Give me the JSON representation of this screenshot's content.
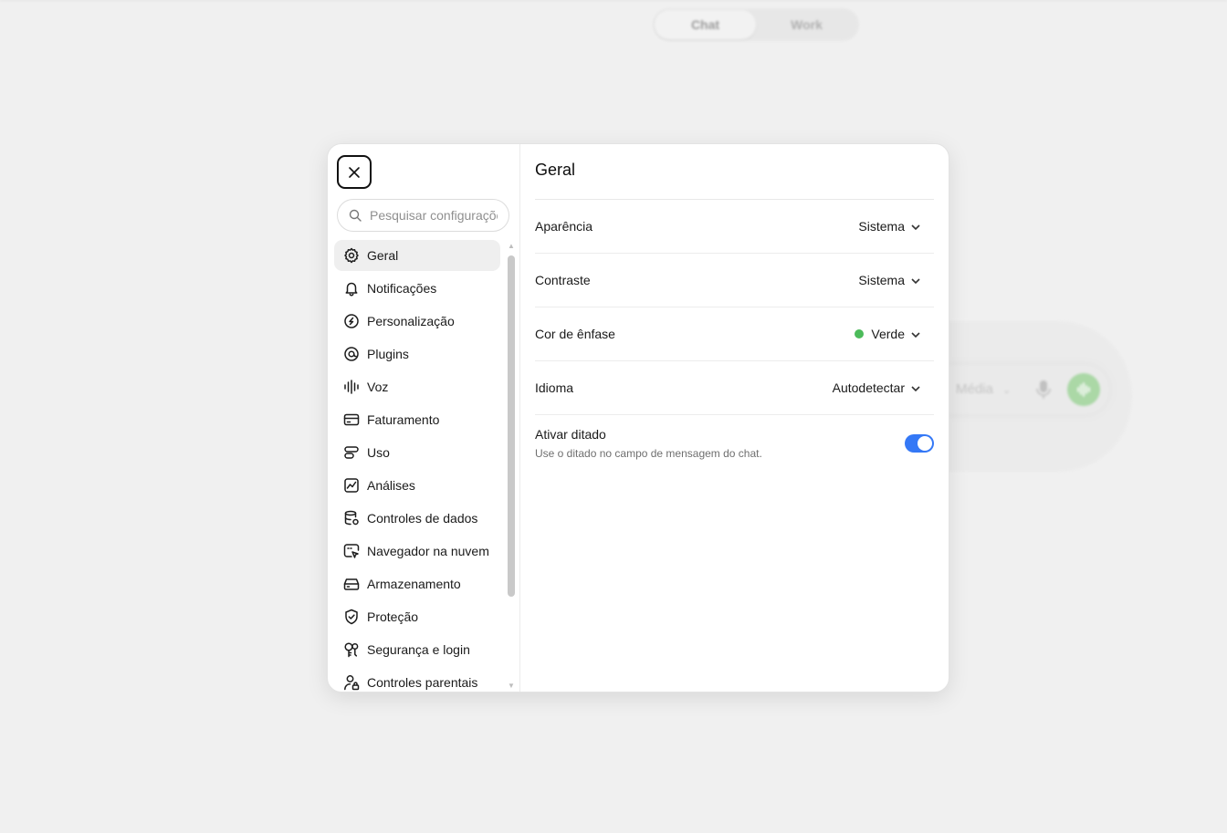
{
  "background": {
    "mode_tabs": [
      {
        "label": "Chat",
        "active": true
      },
      {
        "label": "Work",
        "active": false
      }
    ],
    "composer": {
      "model_label": "Média",
      "mic_icon": "microphone-icon",
      "voice_icon": "voice-waveform-icon",
      "voice_button_color": "#9fd49a"
    }
  },
  "settings": {
    "close_icon": "close-icon",
    "search": {
      "placeholder": "Pesquisar configurações",
      "value": ""
    },
    "nav_items": [
      {
        "label": "Geral",
        "icon": "gear-icon",
        "active": true
      },
      {
        "label": "Notificações",
        "icon": "bell-icon",
        "active": false
      },
      {
        "label": "Personalização",
        "icon": "personalization-icon",
        "active": false
      },
      {
        "label": "Plugins",
        "icon": "plugins-icon",
        "active": false
      },
      {
        "label": "Voz",
        "icon": "voice-waveform-icon",
        "active": false
      },
      {
        "label": "Faturamento",
        "icon": "credit-card-icon",
        "active": false
      },
      {
        "label": "Uso",
        "icon": "usage-icon",
        "active": false
      },
      {
        "label": "Análises",
        "icon": "analytics-chart-icon",
        "active": false
      },
      {
        "label": "Controles de dados",
        "icon": "database-gear-icon",
        "active": false
      },
      {
        "label": "Navegador na nuvem",
        "icon": "cloud-browser-icon",
        "active": false
      },
      {
        "label": "Armazenamento",
        "icon": "storage-drive-icon",
        "active": false
      },
      {
        "label": "Proteção",
        "icon": "shield-check-icon",
        "active": false
      },
      {
        "label": "Segurança e login",
        "icon": "security-key-icon",
        "active": false
      },
      {
        "label": "Controles parentais",
        "icon": "parental-controls-icon",
        "active": false
      }
    ],
    "panel": {
      "title": "Geral",
      "rows": [
        {
          "label": "Aparência",
          "value": "Sistema"
        },
        {
          "label": "Contraste",
          "value": "Sistema"
        },
        {
          "label": "Cor de ênfase",
          "value": "Verde",
          "dot_color": "#4cbb5a"
        },
        {
          "label": "Idioma",
          "value": "Autodetectar"
        }
      ],
      "dictation": {
        "label": "Ativar ditado",
        "description": "Use o ditado no campo de mensagem do chat.",
        "enabled": true,
        "toggle_color": "#3478f6"
      }
    }
  }
}
